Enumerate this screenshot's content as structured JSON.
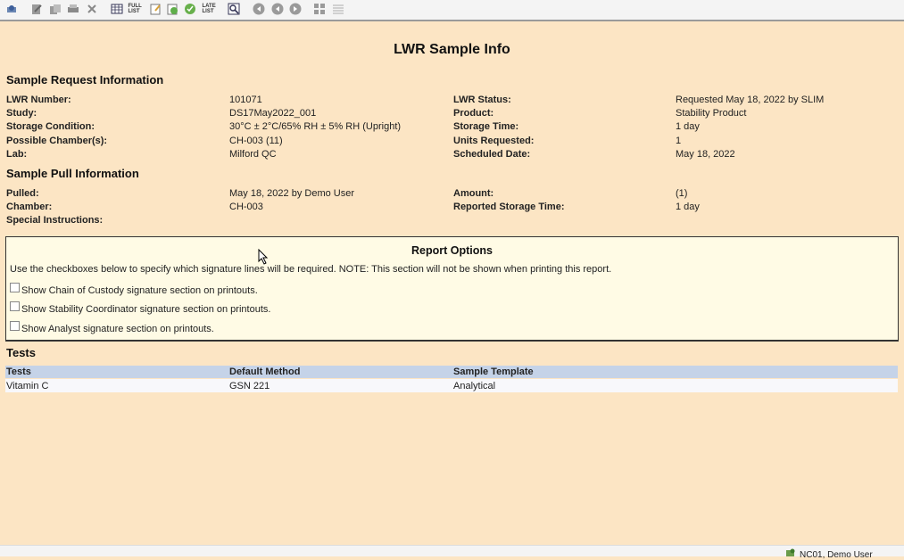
{
  "toolbar": {
    "full_list": "FULL LIST",
    "late_list": "LATE LIST",
    "icons": [
      "print-preview-icon",
      "edit-icon",
      "copy-icon",
      "print-icon",
      "delete-icon",
      "table-icon",
      "full-list-icon",
      "note-icon",
      "refresh-doc-icon",
      "approve-icon",
      "late-list-icon",
      "search-doc-icon",
      "nav-first-icon",
      "nav-prev-icon",
      "nav-next-icon",
      "grid-view-icon",
      "list-view-icon"
    ]
  },
  "page": {
    "title": "LWR Sample Info"
  },
  "sample_request": {
    "heading": "Sample Request Information",
    "left": [
      {
        "label": "LWR Number:",
        "value": "101071"
      },
      {
        "label": "Study:",
        "value": "DS17May2022_001"
      },
      {
        "label": "Storage Condition:",
        "value": "30°C ± 2°C/65% RH ± 5% RH (Upright)"
      },
      {
        "label": "Possible Chamber(s):",
        "value": "CH-003 (11)"
      },
      {
        "label": "Lab:",
        "value": "Milford QC"
      }
    ],
    "right": [
      {
        "label": "LWR Status:",
        "value": "Requested May 18, 2022 by SLIM"
      },
      {
        "label": "Product:",
        "value": "Stability Product"
      },
      {
        "label": "Storage Time:",
        "value": "1 day"
      },
      {
        "label": "Units Requested:",
        "value": "1"
      },
      {
        "label": "Scheduled Date:",
        "value": "May 18, 2022"
      }
    ]
  },
  "sample_pull": {
    "heading": "Sample Pull Information",
    "left": [
      {
        "label": "Pulled:",
        "value": "May 18, 2022 by Demo User"
      },
      {
        "label": "Chamber:",
        "value": "CH-003"
      },
      {
        "label": "Special Instructions:",
        "value": ""
      }
    ],
    "right": [
      {
        "label": "Amount:",
        "value": "(1)"
      },
      {
        "label": "Reported Storage Time:",
        "value": "1 day"
      }
    ]
  },
  "report_options": {
    "title": "Report Options",
    "description": "Use the checkboxes below to specify which signature lines will be required.  NOTE: This section will not be shown when printing this report.",
    "options": [
      {
        "label": "Show Chain of Custody signature section on printouts.",
        "checked": false
      },
      {
        "label": "Show Stability Coordinator signature section on printouts.",
        "checked": false
      },
      {
        "label": "Show Analyst signature section on printouts.",
        "checked": false
      }
    ]
  },
  "tests": {
    "heading": "Tests",
    "columns": [
      "Tests",
      "Default Method",
      "Sample Template"
    ],
    "rows": [
      [
        "Vitamin C",
        "GSN 221",
        "Analytical"
      ]
    ]
  },
  "status_bar": {
    "user": "NC01, Demo User"
  },
  "colors": {
    "background": "#fce5c4",
    "report_bg": "#fffbe5",
    "table_header": "#c5d3e8"
  }
}
